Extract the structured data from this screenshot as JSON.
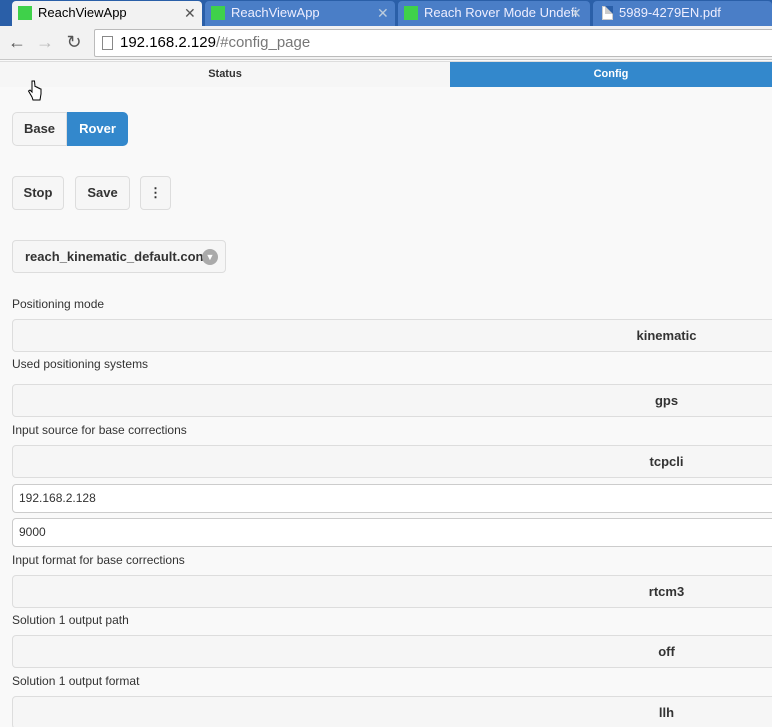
{
  "browser": {
    "tabs": [
      {
        "title": "ReachViewApp",
        "icon": "green-square-icon",
        "active": true
      },
      {
        "title": "ReachViewApp",
        "icon": "green-square-icon",
        "active": false
      },
      {
        "title": "Reach Rover Mode Undefi",
        "icon": "green-square-icon",
        "active": false
      },
      {
        "title": "5989-4279EN.pdf",
        "icon": "document-icon",
        "active": false
      }
    ],
    "close_glyph": "✕",
    "url_host": "192.168.2.129",
    "url_path": "/#config_page"
  },
  "nav": {
    "status_label": "Status",
    "config_label": "Config"
  },
  "mode": {
    "base_label": "Base",
    "rover_label": "Rover",
    "selected": "Rover"
  },
  "actions": {
    "stop_label": "Stop",
    "save_label": "Save",
    "more_label": "⋮"
  },
  "config_file": "reach_kinematic_default.conf",
  "settings": {
    "positioning_mode_label": "Positioning mode",
    "positioning_mode_value": "kinematic",
    "systems_label": "Used positioning systems",
    "systems_value": "gps",
    "input_source_label": "Input source for base corrections",
    "input_source_value": "tcpcli",
    "input_address": "192.168.2.128",
    "input_port": "9000",
    "input_format_label": "Input format for base corrections",
    "input_format_value": "rtcm3",
    "sol1_path_label": "Solution 1 output path",
    "sol1_path_value": "off",
    "sol1_format_label": "Solution 1 output format",
    "sol1_format_value": "llh"
  },
  "colors": {
    "accent": "#3388cc",
    "tabstrip": "#2a5fa8",
    "favicon_green": "#3fd14a"
  }
}
